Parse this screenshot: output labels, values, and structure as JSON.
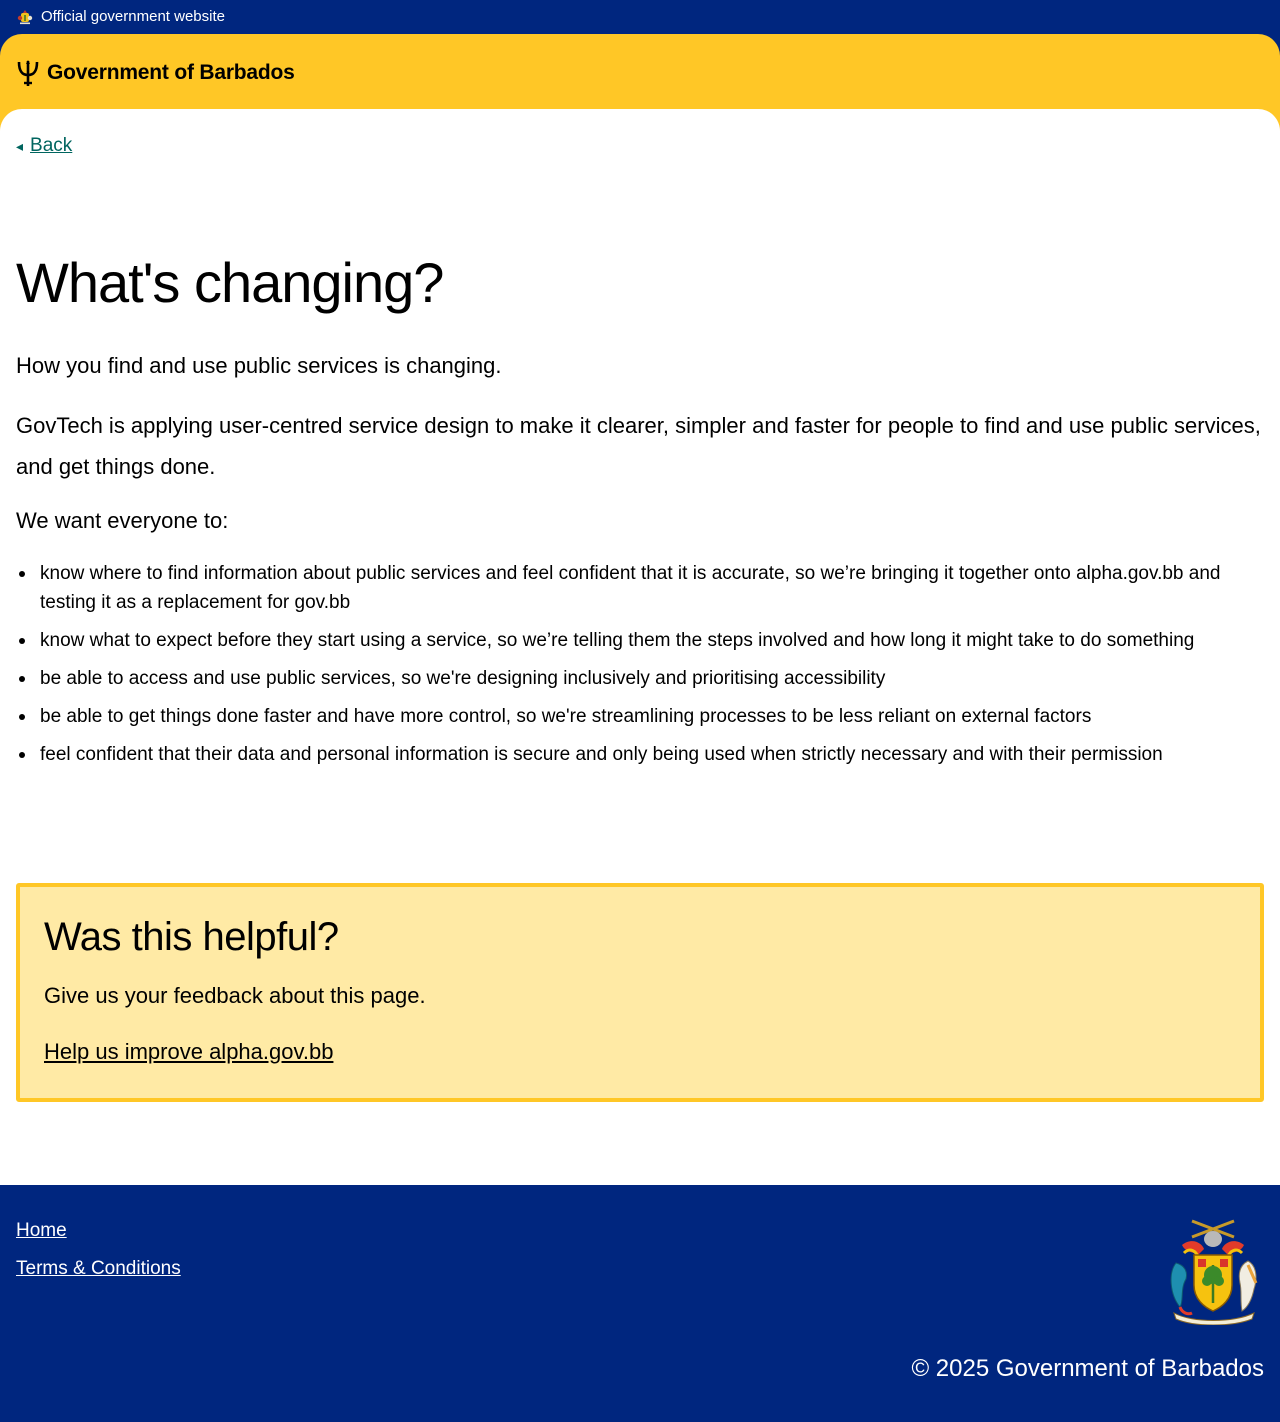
{
  "official_bar": {
    "text": "Official government website",
    "icon": "coat-of-arms-icon"
  },
  "header": {
    "brand": "Government of Barbados",
    "icon": "trident-icon"
  },
  "nav": {
    "back_label": "Back",
    "back_icon": "arrow-left-icon"
  },
  "main": {
    "title": "What's changing?",
    "lead": "How you find and use public services is changing.",
    "paragraph": "GovTech is applying user-centred service design to make it clearer, simpler and faster for people to find and use public services, and get things done.",
    "intro": "We want everyone to:",
    "items": [
      "know where to find information about public services and feel confident that it is accurate, so we’re bringing it together onto alpha.gov.bb and testing it as a replacement for gov.bb",
      "know what to expect before they start using a service, so we’re telling them the steps involved and how long it might take to do something",
      "be able to access and use public services, so we're designing inclusively and prioritising accessibility",
      "be able to get things done faster and have more control, so we're streamlining processes to be less reliant on external factors",
      "feel confident that their data and personal information is secure and only being used when strictly necessary and with their permission"
    ]
  },
  "feedback": {
    "heading": "Was this helpful?",
    "text": "Give us your feedback about this page.",
    "link": "Help us improve alpha.gov.bb"
  },
  "footer": {
    "links": [
      "Home",
      "Terms & Conditions"
    ],
    "copyright": "© 2025 Government of Barbados",
    "icon": "coat-of-arms-icon"
  },
  "colors": {
    "navy": "#00267f",
    "gold": "#ffc726",
    "feedback_bg": "#ffeaa5",
    "link_teal": "#00655f"
  }
}
